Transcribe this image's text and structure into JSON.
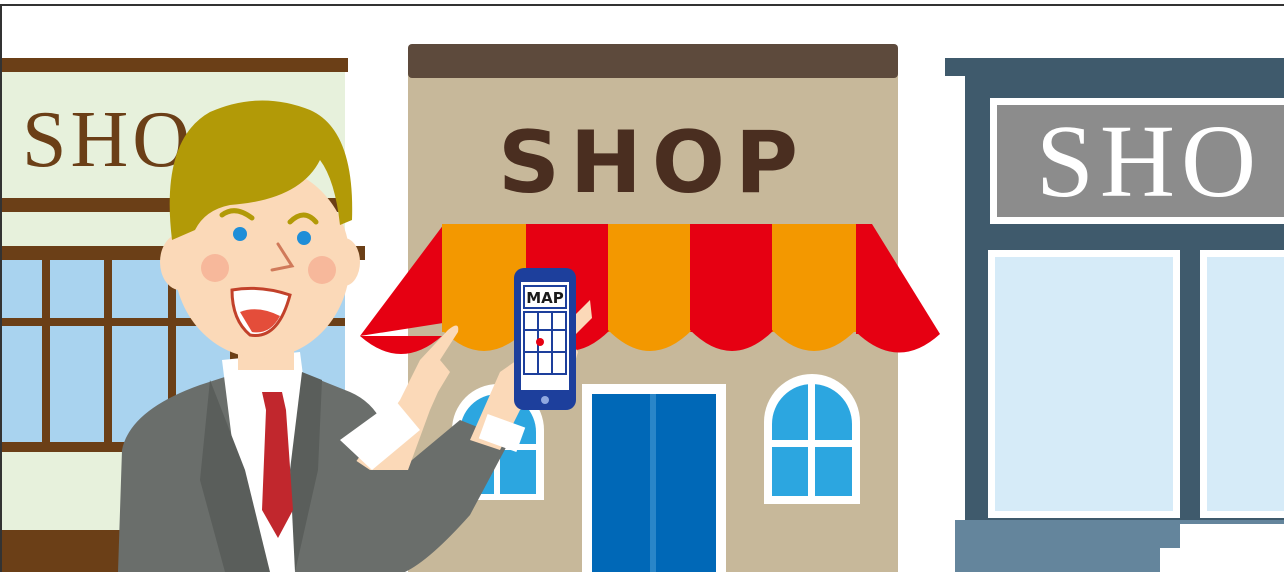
{
  "left_shop": {
    "sign_text": "SHO"
  },
  "center_shop": {
    "sign_text": "SHOP"
  },
  "right_shop": {
    "sign_text": "SHO"
  },
  "phone": {
    "screen_label": "MAP"
  },
  "colors": {
    "center_roof": "#5d4a3c",
    "center_wall": "#c7b89a",
    "center_sign_text": "#4a2e20",
    "awning_red": "#e60012",
    "awning_orange": "#f39800",
    "door_blue": "#0068b7",
    "window_blue": "#2ca6e0",
    "left_sign_bg": "#e7f1dc",
    "left_trim_brown": "#6b3f17",
    "left_window": "#a9d3ef",
    "right_frame": "#3f5a6c",
    "right_sign_grey": "#8c8c8c",
    "right_window": "#d6ebf8",
    "hair": "#b29a07",
    "skin": "#fbd9b8",
    "suit": "#6a6e6b",
    "tie": "#c1272d",
    "phone_body": "#1d3f9c"
  }
}
